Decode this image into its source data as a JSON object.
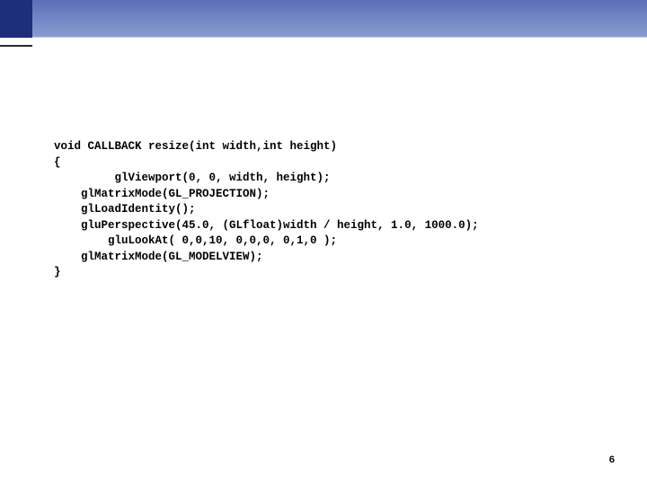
{
  "code": {
    "line1": "void CALLBACK resize(int width,int height)",
    "line2": "{",
    "line3": "         glViewport(0, 0, width, height);",
    "line4": "    glMatrixMode(GL_PROJECTION);",
    "line5": "    glLoadIdentity();",
    "line6": "    gluPerspective(45.0, (GLfloat)width / height, 1.0, 1000.0);",
    "line7": "        gluLookAt( 0,0,10, 0,0,0, 0,1,0 );",
    "line8": "    glMatrixMode(GL_MODELVIEW);",
    "line9": "}"
  },
  "pageNumber": "6"
}
